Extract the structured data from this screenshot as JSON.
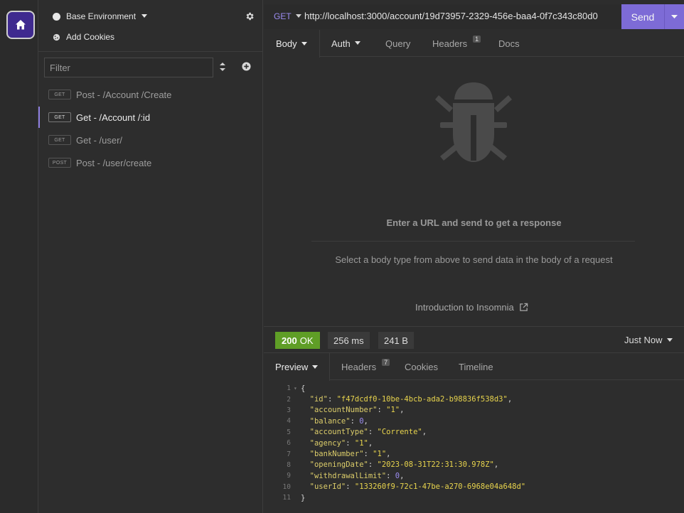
{
  "sidebar": {
    "environment_label": "Base Environment",
    "cookies_label": "Add Cookies",
    "filter_placeholder": "Filter",
    "requests": [
      {
        "method": "GET",
        "name": "Post - /Account /Create"
      },
      {
        "method": "GET",
        "name": "Get - /Account /:id"
      },
      {
        "method": "GET",
        "name": "Get - /user/"
      },
      {
        "method": "POST",
        "name": "Post - /user/create"
      }
    ]
  },
  "request": {
    "method": "GET",
    "url": "http://localhost:3000/account/19d73957-2329-456e-baa4-0f7c343c80d0",
    "send_label": "Send",
    "tabs": {
      "body": "Body",
      "auth": "Auth",
      "query": "Query",
      "headers": "Headers",
      "headers_count": "1",
      "docs": "Docs"
    },
    "empty_title": "Enter a URL and send to get a response",
    "empty_desc": "Select a body type from above to send data in the body of a request",
    "intro_link": "Introduction to Insomnia"
  },
  "response": {
    "status_code": "200",
    "status_text": "OK",
    "time": "256 ms",
    "size": "241 B",
    "timestamp": "Just Now",
    "tabs": {
      "preview": "Preview",
      "headers": "Headers",
      "headers_count": "7",
      "cookies": "Cookies",
      "timeline": "Timeline"
    },
    "body_lines": [
      {
        "n": "1",
        "text": "{"
      },
      {
        "n": "2",
        "key": "\"id\"",
        "val": "\"f47dcdf0-10be-4bcb-ada2-b98836f538d3\"",
        "type": "s",
        "comma": ","
      },
      {
        "n": "3",
        "key": "\"accountNumber\"",
        "val": "\"1\"",
        "type": "s",
        "comma": ","
      },
      {
        "n": "4",
        "key": "\"balance\"",
        "val": "0",
        "type": "n",
        "comma": ","
      },
      {
        "n": "5",
        "key": "\"accountType\"",
        "val": "\"Corrente\"",
        "type": "s",
        "comma": ","
      },
      {
        "n": "6",
        "key": "\"agency\"",
        "val": "\"1\"",
        "type": "s",
        "comma": ","
      },
      {
        "n": "7",
        "key": "\"bankNumber\"",
        "val": "\"1\"",
        "type": "s",
        "comma": ","
      },
      {
        "n": "8",
        "key": "\"openingDate\"",
        "val": "\"2023-08-31T22:31:30.978Z\"",
        "type": "s",
        "comma": ","
      },
      {
        "n": "9",
        "key": "\"withdrawalLimit\"",
        "val": "0",
        "type": "n",
        "comma": ","
      },
      {
        "n": "10",
        "key": "\"userId\"",
        "val": "\"133260f9-72c1-47be-a270-6968e04a648d\"",
        "type": "s",
        "comma": ""
      },
      {
        "n": "11",
        "text": "}"
      }
    ]
  },
  "colors": {
    "accent": "#7d6bd6",
    "status_ok": "#5f9e26",
    "string": "#e8d44d",
    "number": "#9b8cf0"
  }
}
